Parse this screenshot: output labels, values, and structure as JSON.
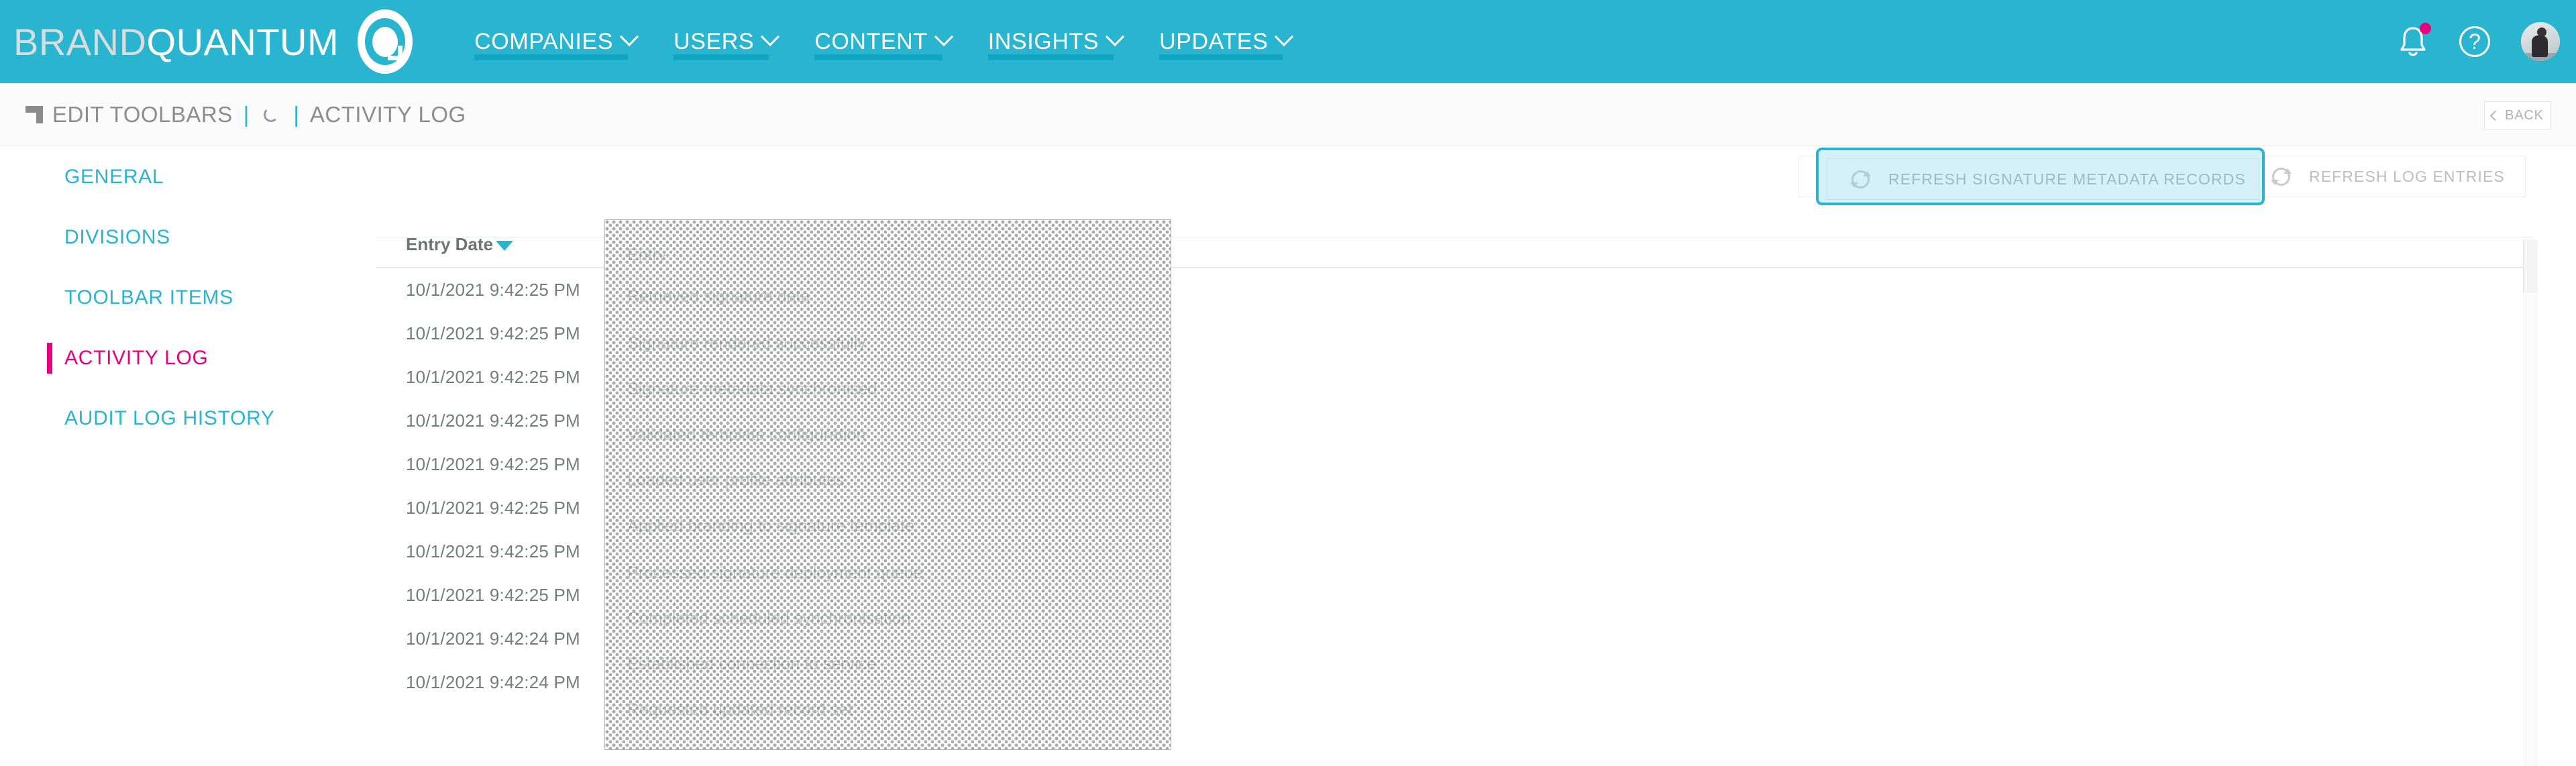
{
  "brand": {
    "name_part1": "BRAND",
    "name_part2": "QUANTUM",
    "logo_icon": "quantum-q-logo"
  },
  "topnav": {
    "items": [
      {
        "label": "COMPANIES",
        "icon": "chevron-down-icon"
      },
      {
        "label": "USERS",
        "icon": "chevron-down-icon"
      },
      {
        "label": "CONTENT",
        "icon": "chevron-down-icon"
      },
      {
        "label": "INSIGHTS",
        "icon": "chevron-down-icon"
      },
      {
        "label": "UPDATES",
        "icon": "chevron-down-icon"
      }
    ],
    "notifications_icon": "bell-icon",
    "notifications_badge": "",
    "help_icon": "question-mark-icon",
    "help_label": "?",
    "avatar_icon": "user-avatar"
  },
  "breadcrumb": {
    "corner_icon": "corner-bracket-icon",
    "title": "EDIT TOOLBARS",
    "separator1": "|",
    "spinner_icon": "loading-spinner-icon",
    "separator2": "|",
    "section": "ACTIVITY LOG",
    "back_label": "BACK",
    "back_icon": "chevron-left-icon"
  },
  "sidebar": {
    "items": [
      {
        "label": "GENERAL",
        "active": false
      },
      {
        "label": "DIVISIONS",
        "active": false
      },
      {
        "label": "TOOLBAR ITEMS",
        "active": false
      },
      {
        "label": "ACTIVITY LOG",
        "active": true
      },
      {
        "label": "AUDIT LOG HISTORY",
        "active": false
      }
    ]
  },
  "actions": {
    "refresh_metadata_label": "REFRESH SIGNATURE METADATA RECORDS",
    "refresh_metadata_icon": "refresh-icon",
    "refresh_log_label": "REFRESH LOG ENTRIES",
    "refresh_log_icon": "refresh-icon",
    "focused_button": "REFRESH SIGNATURE METADATA RECORDS"
  },
  "table": {
    "columns": [
      {
        "label": "Entry Date",
        "sort_icon": "sort-descending-caret",
        "sorted": true
      }
    ],
    "rows": [
      {
        "entry_date": "10/1/2021 9:42:25 PM"
      },
      {
        "entry_date": "10/1/2021 9:42:25 PM"
      },
      {
        "entry_date": "10/1/2021 9:42:25 PM"
      },
      {
        "entry_date": "10/1/2021 9:42:25 PM"
      },
      {
        "entry_date": "10/1/2021 9:42:25 PM"
      },
      {
        "entry_date": "10/1/2021 9:42:25 PM"
      },
      {
        "entry_date": "10/1/2021 9:42:25 PM"
      },
      {
        "entry_date": "10/1/2021 9:42:25 PM"
      },
      {
        "entry_date": "10/1/2021 9:42:24 PM"
      },
      {
        "entry_date": "10/1/2021 9:42:24 PM"
      }
    ]
  },
  "redaction": {
    "note": "masked-region-overlay"
  },
  "colors": {
    "brand_teal": "#29B4D0",
    "nav_underline": "#11A5C4",
    "accent_pink": "#E6007E",
    "focus_border": "#2BB3D4",
    "focus_fill": "#D4F0F8",
    "text_grey": "#767B7E",
    "muted_grey": "#bdbdbd"
  }
}
